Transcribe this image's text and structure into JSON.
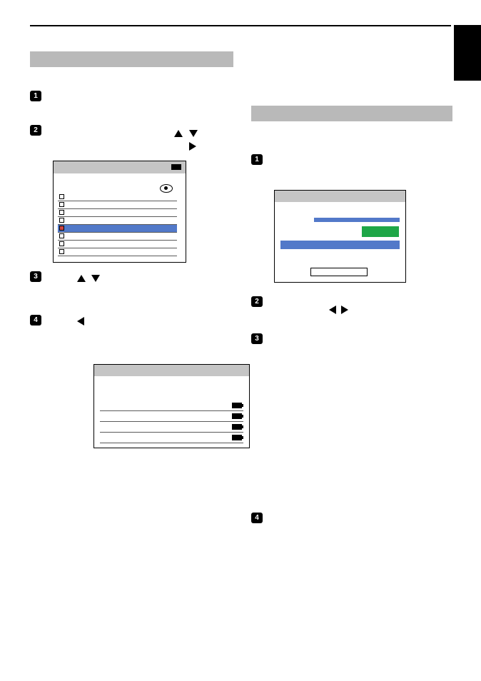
{
  "steps_left": [
    "1",
    "2",
    "3",
    "4"
  ],
  "steps_right": [
    "1",
    "2",
    "3",
    "4"
  ],
  "ui1": {
    "rows": 8,
    "selected_index": 4
  },
  "ui3": {
    "rows": 4
  }
}
